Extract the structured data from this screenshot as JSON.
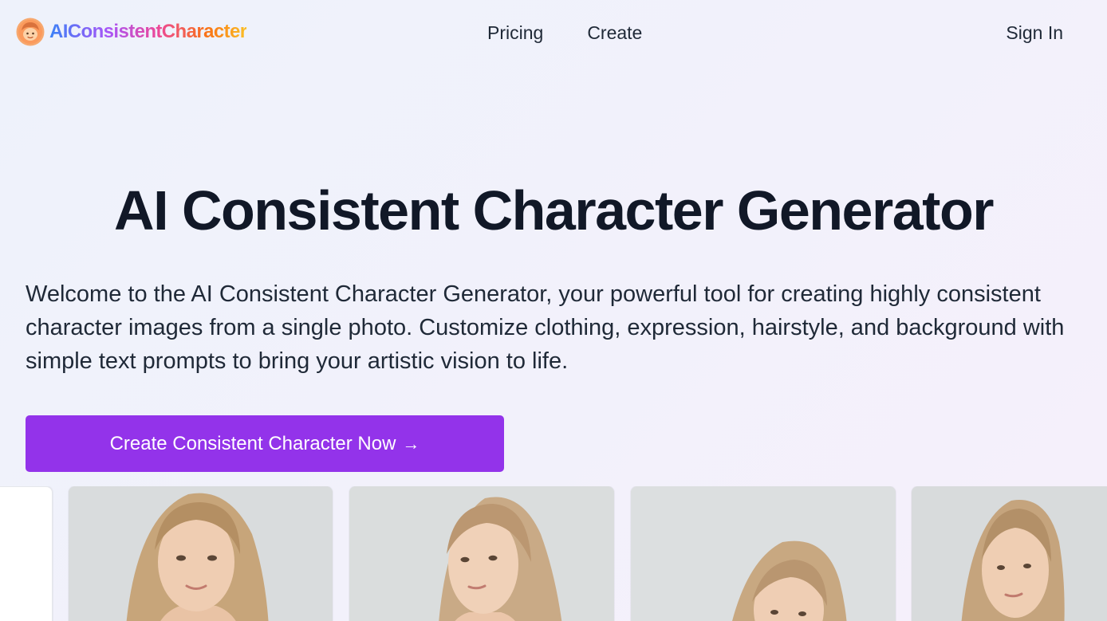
{
  "header": {
    "logo_text": "AIConsistentCharacter",
    "nav": [
      {
        "label": "Pricing"
      },
      {
        "label": "Create"
      }
    ],
    "sign_in_label": "Sign In"
  },
  "hero": {
    "title": "AI Consistent Character Generator",
    "description": "Welcome to the AI Consistent Character Generator, your powerful tool for creating highly consistent character images from a single photo. Customize clothing, expression, hairstyle, and background with simple text prompts to bring your artistic vision to life.",
    "cta_label": "Create Consistent Character Now",
    "cta_icon": "arrow-right-icon"
  },
  "colors": {
    "accent": "#9333ea",
    "heading": "#111827",
    "background": "#eff2fb"
  },
  "gallery": {
    "items": [
      {
        "kind": "placeholder"
      },
      {
        "kind": "portrait",
        "pose": "front"
      },
      {
        "kind": "portrait",
        "pose": "three-quarter-left"
      },
      {
        "kind": "portrait",
        "pose": "low-tilted"
      },
      {
        "kind": "portrait",
        "pose": "turned-right"
      }
    ]
  }
}
